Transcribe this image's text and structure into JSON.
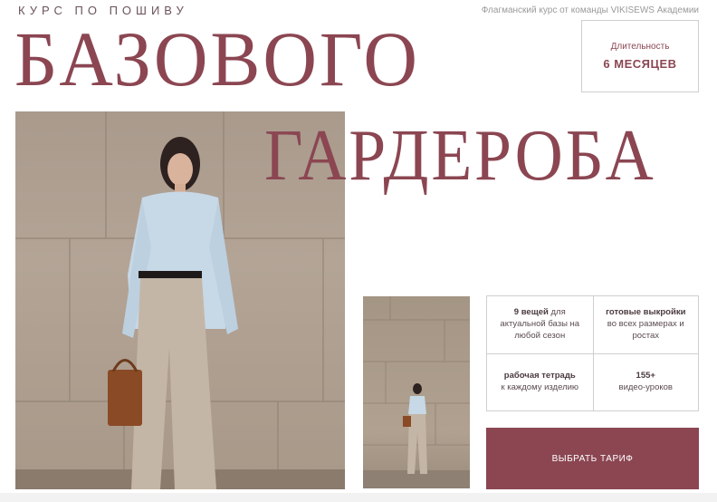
{
  "header": {
    "kicker": "КУРС ПО ПОШИВУ",
    "tagline": "Флагманский курс от команды VIKISEWS Академии"
  },
  "hero": {
    "title_line1": "БАЗОВОГО",
    "title_line2": "ГАРДЕРОБА"
  },
  "duration": {
    "label": "Длительность",
    "value": "6 МЕСЯЦЕВ"
  },
  "features": [
    {
      "bold": "9 вещей",
      "inline": " для",
      "text": "актуальной базы на любой сезон"
    },
    {
      "bold": "готовые выкройки",
      "inline": "",
      "text": "во всех размерах и ростах"
    },
    {
      "bold": "рабочая тетрадь",
      "inline": "",
      "text": "к каждому изделию"
    },
    {
      "bold": "155+",
      "inline": "",
      "text": "видео-уроков"
    }
  ],
  "cta": {
    "label": "ВЫБРАТЬ ТАРИФ"
  },
  "colors": {
    "accent": "#8b4652",
    "border": "#cfcfcf"
  }
}
